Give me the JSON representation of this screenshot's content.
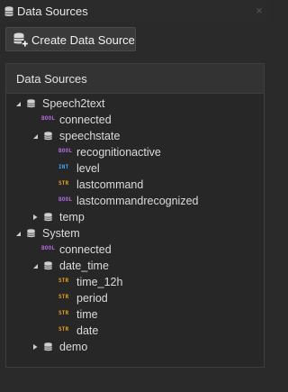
{
  "window": {
    "title": "Data Sources",
    "close_glyph": "×",
    "title_icon": "database-icon"
  },
  "toolbar": {
    "create_label": "Create Data Source",
    "create_icon": "database-add-icon"
  },
  "sources": {
    "header": "Data Sources",
    "tree": [
      {
        "label": "Speech2text",
        "kind": "source",
        "expanded": true
      },
      {
        "label": "connected",
        "kind": "field",
        "type": "BOOL"
      },
      {
        "label": "speechstate",
        "kind": "folder",
        "expanded": true
      },
      {
        "label": "recognitionactive",
        "kind": "field",
        "type": "BOOL"
      },
      {
        "label": "level",
        "kind": "field",
        "type": "INT"
      },
      {
        "label": "lastcommand",
        "kind": "field",
        "type": "STR"
      },
      {
        "label": "lastcommandrecognized",
        "kind": "field",
        "type": "BOOL"
      },
      {
        "label": "temp",
        "kind": "folder",
        "expanded": false
      },
      {
        "label": "System",
        "kind": "source",
        "expanded": true
      },
      {
        "label": "connected",
        "kind": "field",
        "type": "BOOL"
      },
      {
        "label": "date_time",
        "kind": "folder",
        "expanded": true
      },
      {
        "label": "time_12h",
        "kind": "field",
        "type": "STR"
      },
      {
        "label": "period",
        "kind": "field",
        "type": "STR"
      },
      {
        "label": "time",
        "kind": "field",
        "type": "STR"
      },
      {
        "label": "date",
        "kind": "field",
        "type": "STR"
      },
      {
        "label": "demo",
        "kind": "folder",
        "expanded": false
      }
    ]
  },
  "colors": {
    "bool": "#b66be0",
    "int": "#3fa9ff",
    "str": "#e8a11a"
  }
}
